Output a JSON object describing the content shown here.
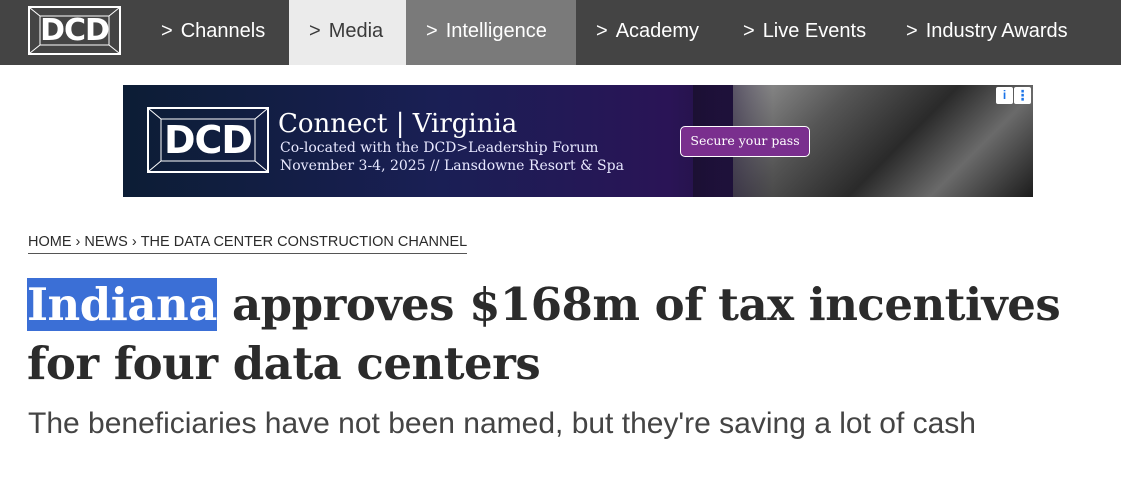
{
  "nav": {
    "logo_text": "DCD",
    "chevron": ">",
    "items": [
      {
        "label": "Channels"
      },
      {
        "label": "Media"
      },
      {
        "label": "Intelligence"
      },
      {
        "label": "Academy"
      },
      {
        "label": "Live Events"
      },
      {
        "label": "Industry Awards"
      }
    ]
  },
  "ad": {
    "logo_text": "DCD",
    "title": "Connect | Virginia",
    "line1": "Co-located with the DCD>Leadership Forum",
    "line2": "November 3-4, 2025 // Lansdowne Resort & Spa",
    "cta": "Secure your pass",
    "info_icon": "i",
    "more_icon": "⋮"
  },
  "breadcrumb": {
    "items": [
      "HOME",
      "NEWS",
      "THE DATA CENTER CONSTRUCTION CHANNEL"
    ],
    "separator": "›"
  },
  "article": {
    "headline_highlight": "Indiana",
    "headline_rest": " approves $168m of tax incentives for four data centers",
    "subtitle": "The beneficiaries have not been named, but they're saving a lot of cash"
  },
  "colors": {
    "nav_bg": "#444444",
    "nav_active_media": "#ebebeb",
    "nav_hover_intelligence": "#7a7a7a",
    "highlight": "#3b6fd6",
    "cta_bg": "#7a2f8e"
  }
}
